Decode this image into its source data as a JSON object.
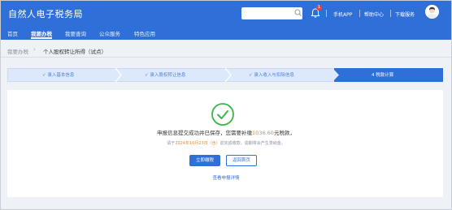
{
  "header": {
    "title": "自然人电子税务局",
    "search_placeholder": "",
    "notification_count": "1",
    "links": [
      "手机APP",
      "帮助中心",
      "下载服务"
    ]
  },
  "nav": {
    "items": [
      "首页",
      "我要办税",
      "我要查询",
      "公众服务",
      "特色应用"
    ],
    "active_index": 1
  },
  "breadcrumb": {
    "parent": "我要办税",
    "current": "个人股权转让所得（试点）"
  },
  "steps": {
    "items": [
      "✓ 录入基本信息",
      "✓ 录入股权转让信息",
      "✓ 录入收入与扣除信息",
      "4  税款计算"
    ],
    "active_index": 3
  },
  "result": {
    "message_prefix": "申报信息提交成功并已保存，您需要补缴",
    "amount": "1036.60",
    "message_suffix": "元税款，",
    "sub_prefix": "请于",
    "deadline": "2024年10月23日（含）",
    "sub_suffix": "前完成缴款，逾期将会产生滞纳金。",
    "pay_button": "立即缴税",
    "home_button": "返回首页",
    "detail_link": "查看申报详情"
  },
  "colors": {
    "brand_blue": "#2f6fd8",
    "success_green": "#3bb54a",
    "amount_orange": "#e08a3c"
  }
}
